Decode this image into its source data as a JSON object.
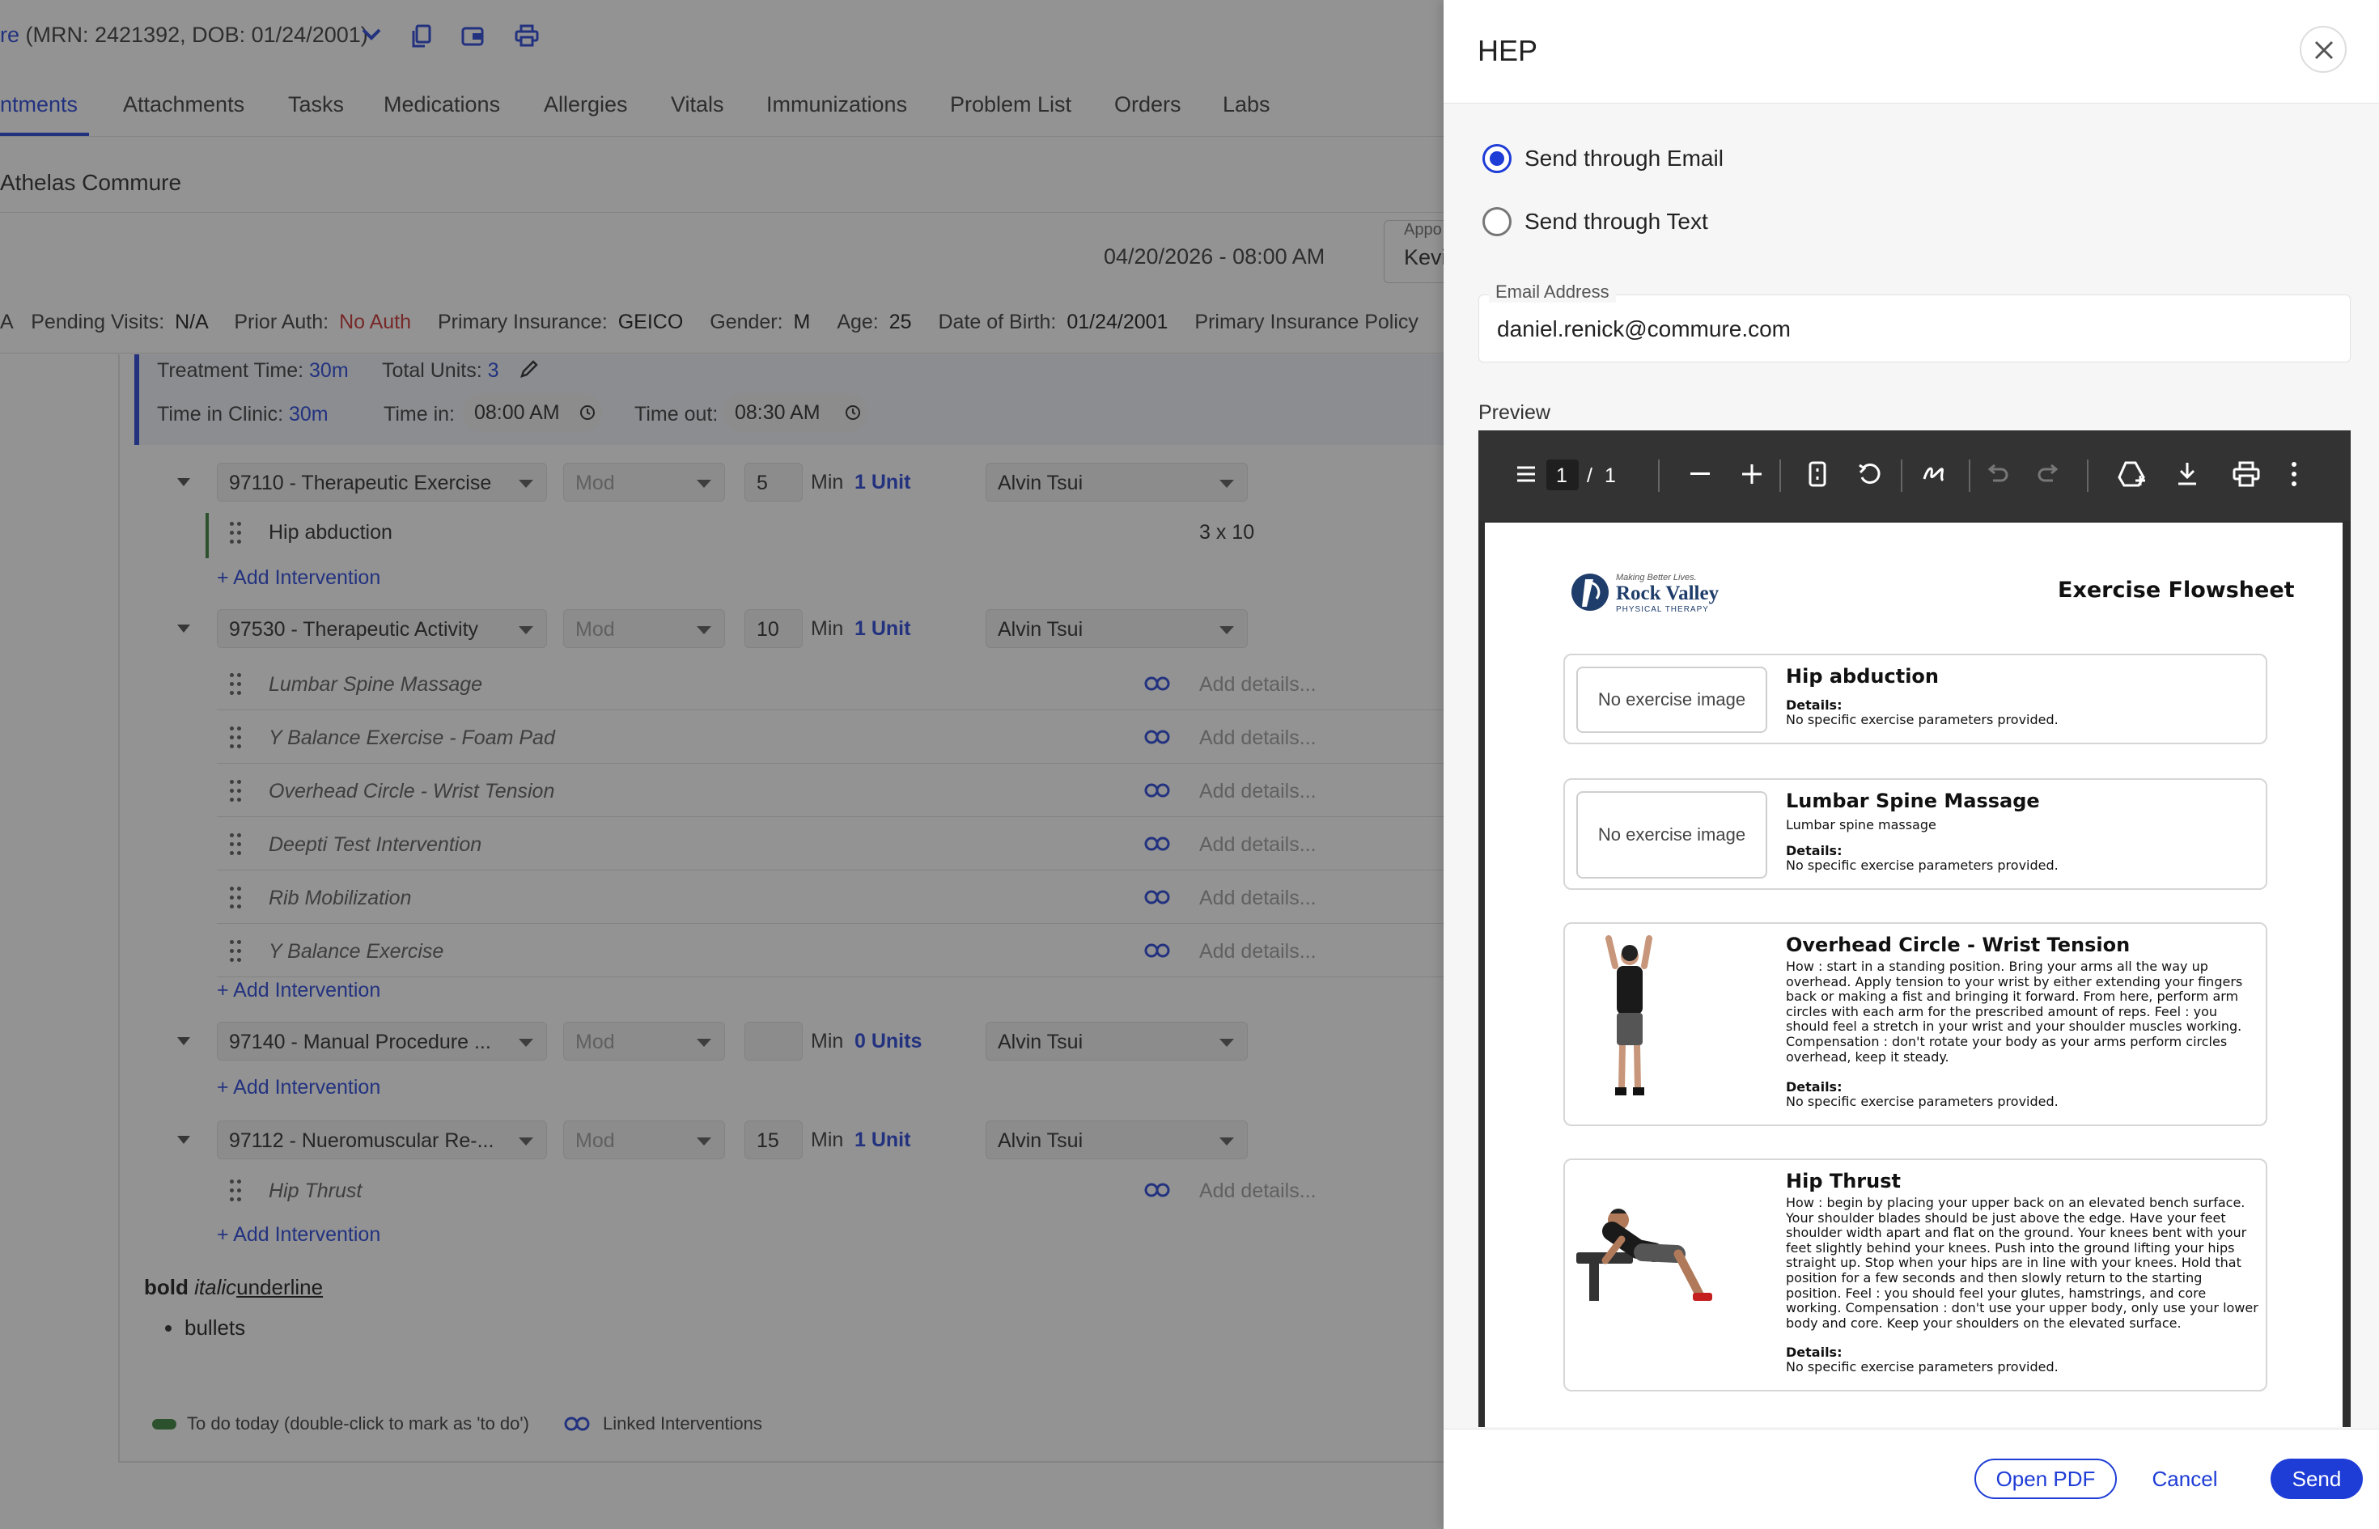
{
  "header": {
    "patient_prefix": "re",
    "patient_info": " (MRN: 2421392, DOB: 01/24/2001)"
  },
  "tabs": [
    "ntments",
    "Attachments",
    "Tasks",
    "Medications",
    "Allergies",
    "Vitals",
    "Immunizations",
    "Problem List",
    "Orders",
    "Labs"
  ],
  "clinic_name": "Athelas Commure",
  "appointment": {
    "datetime": "04/20/2026 - 08:00 AM",
    "appt_label": "Appo",
    "appt_value": "Kevi"
  },
  "info_bar": {
    "a_prefix": "A",
    "pending_label": "Pending Visits:",
    "pending_value": "N/A",
    "prior_label": "Prior Auth:",
    "prior_value": "No Auth",
    "insurance_label": "Primary Insurance:",
    "insurance_value": "GEICO",
    "gender_label": "Gender:",
    "gender_value": "M",
    "age_label": "Age:",
    "age_value": "25",
    "dob_label": "Date of Birth:",
    "dob_value": "01/24/2001",
    "policy_label": "Primary Insurance Policy"
  },
  "summary": {
    "treatment_label": "Treatment Time:",
    "treatment_value": "30m",
    "units_label": "Total Units:",
    "units_value": "3",
    "clinic_label": "Time in Clinic:",
    "clinic_value": "30m",
    "time_in_label": "Time in:",
    "time_in_value": "08:00 AM",
    "time_out_label": "Time out:",
    "time_out_value": "08:30 AM"
  },
  "codes": [
    {
      "code": "97110 - Therapeutic Exercise",
      "mod": "Mod",
      "min_value": "5",
      "min_label": "Min",
      "units": "1 Unit",
      "provider": "Alvin Tsui"
    },
    {
      "code": "97530 - Therapeutic Activity",
      "mod": "Mod",
      "min_value": "10",
      "min_label": "Min",
      "units": "1 Unit",
      "provider": "Alvin Tsui"
    },
    {
      "code": "97140 - Manual Procedure ...",
      "mod": "Mod",
      "min_value": "",
      "min_label": "Min",
      "units": "0 Units",
      "provider": "Alvin Tsui"
    },
    {
      "code": "97112 - Nueromuscular Re-...",
      "mod": "Mod",
      "min_value": "15",
      "min_label": "Min",
      "units": "1 Unit",
      "provider": "Alvin Tsui"
    }
  ],
  "interventions": {
    "hip_abduction": "Hip abduction",
    "hip_abduction_detail": "3 x 10",
    "activity": [
      "Lumbar Spine Massage",
      "Y Balance Exercise - Foam Pad",
      "Overhead Circle - Wrist Tension",
      "Deepti Test Intervention",
      "Rib Mobilization",
      "Y Balance Exercise"
    ],
    "hip_thrust": "Hip Thrust",
    "add_details": "Add details...",
    "add_intervention": "+ Add Intervention"
  },
  "notes": {
    "bold": "bold",
    "italic": "italic",
    "underline": "underline",
    "bullet": "bullets"
  },
  "legend": {
    "todo": "To do today (double-click to mark as 'to do')",
    "linked": "Linked Interventions"
  },
  "hep": {
    "title": "HEP",
    "option_email": "Send through Email",
    "option_text": "Send through Text",
    "email_label": "Email Address",
    "email_value": "daniel.renick@commure.com",
    "preview_label": "Preview",
    "pdf_page_current": "1",
    "pdf_page_sep": "/",
    "pdf_page_total": "1",
    "brand_tagline": "Making Better Lives.",
    "brand_name": "Rock Valley",
    "brand_sub": "PHYSICAL THERAPY",
    "sheet_title": "Exercise Flowsheet",
    "no_image": "No exercise image",
    "details_label": "Details:",
    "details_default": "No specific exercise parameters provided.",
    "cards": [
      {
        "title": "Hip abduction",
        "sub": ""
      },
      {
        "title": "Lumbar Spine Massage",
        "sub": "Lumbar spine massage"
      },
      {
        "title": "Overhead Circle - Wrist Tension",
        "desc": "How : start in a standing position. Bring your arms all the way up overhead. Apply tension to your wrist by either extending your fingers back or making a fist and bringing it forward. From here, perform arm circles with each arm for the prescribed amount of reps. Feel : you should feel a stretch in your wrist and your shoulder muscles working. Compensation : don't rotate your body as your arms perform circles overhead, keep it steady."
      },
      {
        "title": "Hip Thrust",
        "desc": "How : begin by placing your upper back on an elevated bench surface. Your shoulder blades should be just above the edge. Have your feet shoulder width apart and flat on the ground. Your knees bent with your feet slightly behind your knees. Push into the ground lifting your hips straight up. Stop when your hips are in line with your knees. Hold that position for a few seconds and then slowly return to the starting position. Feel : you should feel your glutes, hamstrings, and core working. Compensation : don't use your upper body, only use your lower body and core. Keep your shoulders on the elevated surface."
      }
    ],
    "btn_open_pdf": "Open PDF",
    "btn_cancel": "Cancel",
    "btn_send": "Send"
  },
  "colors": {
    "accent": "#1e3cd6",
    "alert": "#c62828",
    "todo_green": "#2e7d32"
  }
}
